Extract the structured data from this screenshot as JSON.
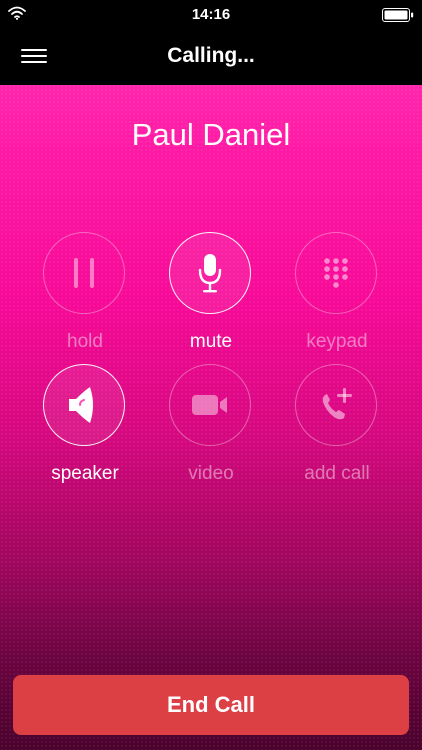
{
  "status_bar": {
    "time": "14:16",
    "wifi_icon": "wifi-icon",
    "battery_icon": "battery-icon"
  },
  "nav": {
    "menu_icon": "hamburger-menu-icon",
    "title": "Calling..."
  },
  "caller": {
    "name": "Paul Daniel"
  },
  "controls": [
    {
      "label": "hold",
      "icon": "pause-icon",
      "active": false
    },
    {
      "label": "mute",
      "icon": "microphone-icon",
      "active": true
    },
    {
      "label": "keypad",
      "icon": "keypad-icon",
      "active": false
    },
    {
      "label": "speaker",
      "icon": "speaker-icon",
      "active": true
    },
    {
      "label": "video",
      "icon": "video-camera-icon",
      "active": false
    },
    {
      "label": "add call",
      "icon": "add-call-icon",
      "active": false
    }
  ],
  "end_call": {
    "label": "End Call",
    "color": "#dc3f44"
  },
  "colors": {
    "background_top": "#ff37b6",
    "background_bottom": "#4a022c",
    "bar_background": "#000000"
  }
}
